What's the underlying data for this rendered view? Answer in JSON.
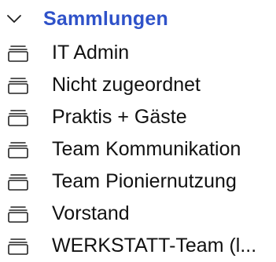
{
  "collections": {
    "title": "Sammlungen",
    "accent_color": "#2f52c9",
    "toggle_icon": "chevron-down-icon",
    "item_icon": "collection-stack-icon",
    "items": [
      {
        "label": "IT Admin"
      },
      {
        "label": "Nicht zugeordnet"
      },
      {
        "label": "Praktis + Gäste"
      },
      {
        "label": "Team Kommunikation"
      },
      {
        "label": "Team Pioniernutzung"
      },
      {
        "label": "Vorstand"
      },
      {
        "label": "WERKSTATT-Team (l..."
      }
    ]
  }
}
